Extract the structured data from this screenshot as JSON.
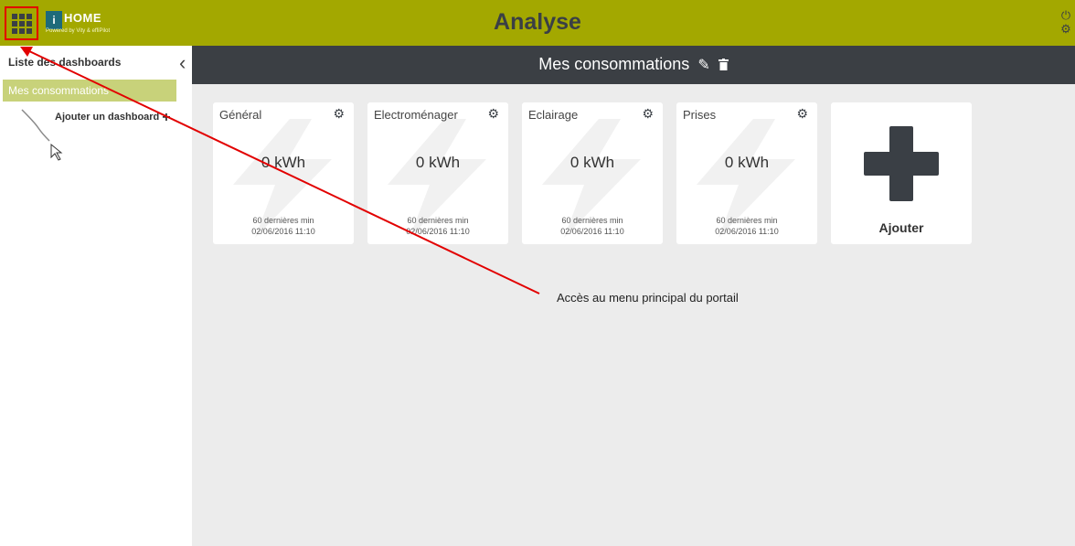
{
  "header": {
    "title": "Analyse",
    "logo_mark": "i",
    "logo_title": "HOME",
    "logo_subtitle": "Powered by Vity & effiPilot",
    "accent_color": "#a3a800",
    "icons": [
      "grid-icon",
      "power-icon",
      "gear-icon"
    ]
  },
  "sidebar": {
    "title": "Liste des dashboards",
    "items": [
      {
        "label": "Mes consommations"
      }
    ],
    "add_label": "Ajouter un dashboard"
  },
  "dashboard": {
    "title": "Mes consommations",
    "header_color": "#3b3f44",
    "tiles": [
      {
        "name": "Général",
        "value": "0 kWh",
        "period": "60 dernières min",
        "date": "02/06/2016 11:10"
      },
      {
        "name": "Electroménager",
        "value": "0 kWh",
        "period": "60 dernières min",
        "date": "02/06/2016 11:10"
      },
      {
        "name": "Eclairage",
        "value": "0 kWh",
        "period": "60 dernières min",
        "date": "02/06/2016 11:10"
      },
      {
        "name": "Prises",
        "value": "0 kWh",
        "period": "60 dernières min",
        "date": "02/06/2016 11:10"
      }
    ],
    "add_tile_label": "Ajouter"
  },
  "annotation": {
    "text": "Accès au menu principal du portail",
    "color": "#e20000"
  }
}
